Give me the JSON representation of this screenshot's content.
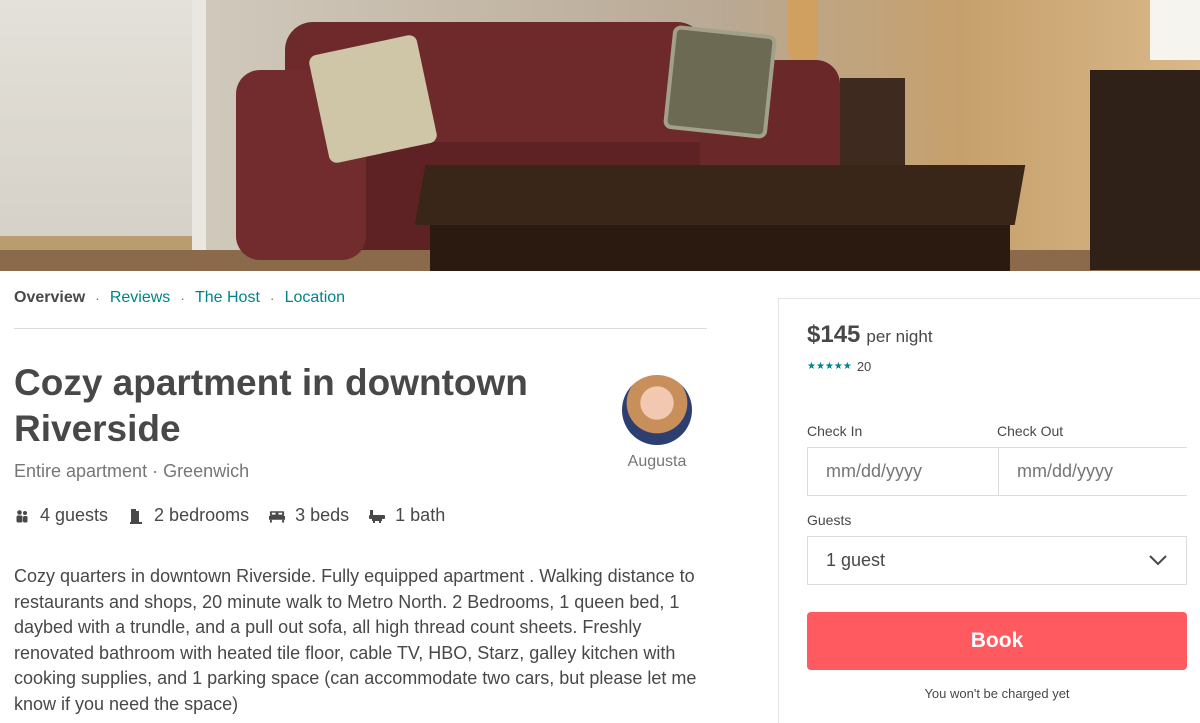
{
  "nav": {
    "tabs": [
      {
        "label": "Overview",
        "active": true
      },
      {
        "label": "Reviews",
        "active": false
      },
      {
        "label": "The Host",
        "active": false
      },
      {
        "label": "Location",
        "active": false
      }
    ],
    "separator": "·"
  },
  "listing": {
    "title": "Cozy apartment in downtown Riverside",
    "subtitle": "Entire apartment · Greenwich",
    "host_name": "Augusta",
    "amenities": [
      {
        "icon": "guests-icon",
        "label": "4 guests"
      },
      {
        "icon": "bedroom-icon",
        "label": "2 bedrooms"
      },
      {
        "icon": "bed-icon",
        "label": "3 beds"
      },
      {
        "icon": "bath-icon",
        "label": "1 bath"
      }
    ],
    "description": "Cozy quarters in downtown Riverside. Fully equipped apartment . Walking distance to restaurants and shops, 20 minute walk to Metro North. 2 Bedrooms, 1 queen bed, 1 daybed with a trundle, and a pull out sofa, all high thread count sheets. Freshly renovated bathroom with heated tile floor, cable TV, HBO, Starz, galley kitchen with cooking supplies, and 1 parking space (can accommodate two cars, but please let me know if you need the space)"
  },
  "booking": {
    "price": "$145",
    "per_night": "per night",
    "stars": "★★★★★",
    "review_count": "20",
    "check_in_label": "Check In",
    "check_out_label": "Check Out",
    "check_in_placeholder": "mm/dd/yyyy",
    "check_out_placeholder": "mm/dd/yyyy",
    "guests_label": "Guests",
    "guests_value": "1 guest",
    "book_label": "Book",
    "note": "You won't be charged yet"
  },
  "colors": {
    "accent": "#008489",
    "book_button": "#ff5a5f",
    "text": "#484848",
    "muted": "#767676"
  }
}
